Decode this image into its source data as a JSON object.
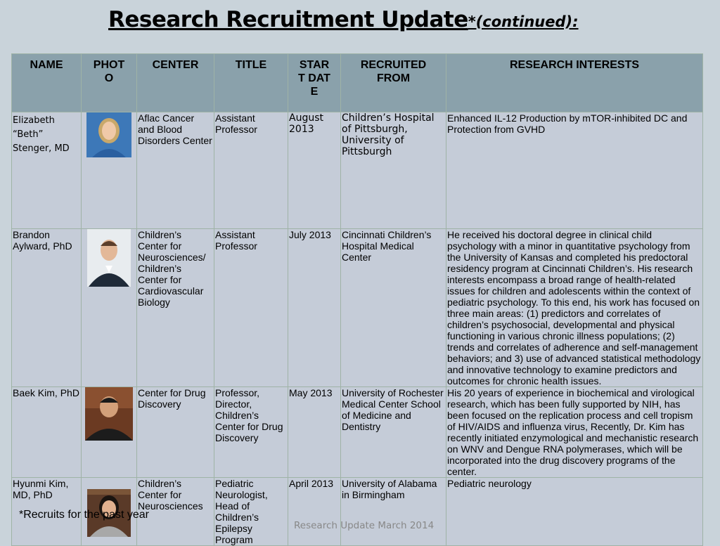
{
  "title": {
    "main": "Research Recruitment Update",
    "sub": "*(continued):"
  },
  "table": {
    "headers": [
      "NAME",
      "PHOTO",
      "CENTER",
      "TITLE",
      "START DATE",
      "RECRUITED FROM",
      "RESEARCH INTERESTS"
    ],
    "rows": [
      {
        "name": "Elizabeth “Beth” Stenger, MD",
        "photo": "portrait-photo",
        "center": "Aflac Cancer and Blood Disorders Center",
        "title": "Assistant Professor",
        "start": "August 2013",
        "from": "Children’s Hospital of Pittsburgh, University of Pittsburgh",
        "interests": "Enhanced IL-12 Production by mTOR-inhibited DC and Protection from GVHD"
      },
      {
        "name": "Brandon Aylward, PhD",
        "photo": "portrait-photo",
        "center": "Children’s Center for Neurosciences/ Children’s Center for Cardiovascular Biology",
        "title": "Assistant Professor",
        "start": "July 2013",
        "from": "Cincinnati Children’s Hospital Medical Center",
        "interests": "He received his doctoral degree in clinical child psychology with a minor in quantitative psychology from the University of Kansas and completed his predoctoral residency program at Cincinnati Children’s. His research interests encompass a broad range of health-related issues for children and adolescents within the context of pediatric psychology. To this end, his work has focused on three main areas: (1) predictors and correlates of children’s psychosocial, developmental and physical functioning in various chronic illness populations; (2) trends and correlates of adherence and self-management behaviors; and 3) use of advanced statistical methodology and innovative technology to examine predictors and outcomes for chronic health issues."
      },
      {
        "name": "Baek Kim, PhD",
        "photo": "portrait-photo",
        "center": "Center for Drug Discovery",
        "title": "Professor, Director, Children’s Center for Drug Discovery",
        "start": "May 2013",
        "from": "University of Rochester Medical Center School of Medicine and Dentistry",
        "interests": "His 20 years of experience in biochemical and virological research, which has been fully supported by NIH, has been focused on the replication process and cell tropism of HIV/AIDS and influenza virus, Recently, Dr. Kim has recently initiated enzymological and mechanistic research on WNV and Dengue RNA polymerases, which will be incorporated into the drug discovery programs of the center."
      },
      {
        "name": "Hyunmi Kim, MD, PhD",
        "photo": "portrait-photo",
        "center": "Children’s Center for Neurosciences",
        "title": "Pediatric Neurologist, Head of Children’s Epilepsy Program",
        "start": "April 2013",
        "from": "University of Alabama in Birmingham",
        "interests": "Pediatric neurology"
      }
    ]
  },
  "footnote": "*Recruits for the past year",
  "footer": "Research Update March 2014"
}
